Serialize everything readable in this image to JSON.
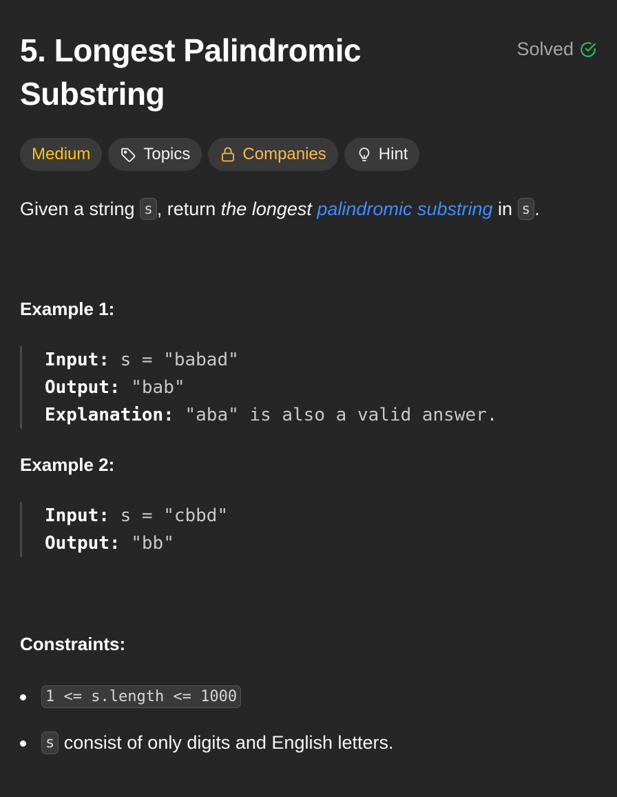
{
  "problem": {
    "title": "5. Longest Palindromic Substring",
    "status": "Solved",
    "status_color": "#2cbb5d"
  },
  "tags": {
    "difficulty": "Medium",
    "difficulty_color": "#ffc01e",
    "topics": "Topics",
    "companies": "Companies",
    "hint": "Hint",
    "icons": {
      "topics": "tag-icon",
      "companies": "lock-icon",
      "hint": "lightbulb-icon"
    }
  },
  "description": {
    "part1": "Given a string ",
    "var_s": "s",
    "part2": ", return ",
    "emph": "the longest ",
    "link": "palindromic substring",
    "part3": " in ",
    "var_s2": "s",
    "part4": "."
  },
  "examples": [
    {
      "heading": "Example 1:",
      "input_label": "Input:",
      "input_value": " s = \"babad\"",
      "output_label": "Output:",
      "output_value": " \"bab\"",
      "explanation_label": "Explanation:",
      "explanation_value": " \"aba\" is also a valid answer."
    },
    {
      "heading": "Example 2:",
      "input_label": "Input:",
      "input_value": " s = \"cbbd\"",
      "output_label": "Output:",
      "output_value": " \"bb\""
    }
  ],
  "constraints": {
    "heading": "Constraints:",
    "item1_code": "1 <= s.length <= 1000",
    "item2_code": "s",
    "item2_text": " consist of only digits and English letters."
  }
}
